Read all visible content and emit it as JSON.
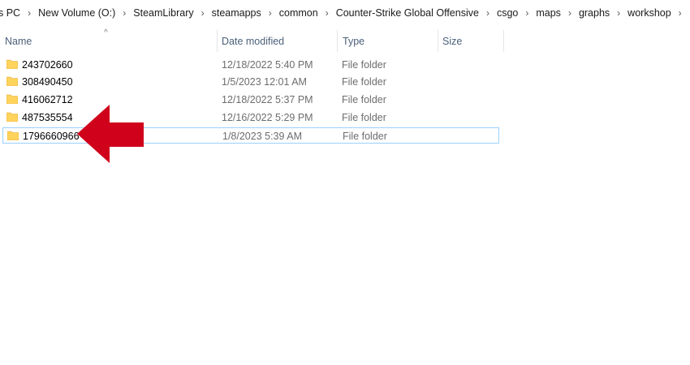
{
  "breadcrumb": [
    "s PC",
    "New Volume (O:)",
    "SteamLibrary",
    "steamapps",
    "common",
    "Counter-Strike Global Offensive",
    "csgo",
    "maps",
    "graphs",
    "workshop"
  ],
  "header": {
    "name": "Name",
    "date": "Date modified",
    "type": "Type",
    "size": "Size"
  },
  "rows": [
    {
      "name": "243702660",
      "date": "12/18/2022 5:40 PM",
      "type": "File folder",
      "size": ""
    },
    {
      "name": "308490450",
      "date": "1/5/2023 12:01 AM",
      "type": "File folder",
      "size": ""
    },
    {
      "name": "416062712",
      "date": "12/18/2022 5:37 PM",
      "type": "File folder",
      "size": ""
    },
    {
      "name": "487535554",
      "date": "12/16/2022 5:29 PM",
      "type": "File folder",
      "size": ""
    },
    {
      "name": "1796660966",
      "date": "1/8/2023 5:39 AM",
      "type": "File folder",
      "size": ""
    }
  ],
  "selected_row": 4,
  "colors": {
    "folder": "#ffd35c",
    "selection_border": "#99d1ff",
    "arrow": "#d0021b"
  },
  "icons": {
    "folder": "folder-icon",
    "separator": "chevron-right-icon",
    "sort": "sort-ascending-icon",
    "pointer": "red-arrow-icon"
  }
}
